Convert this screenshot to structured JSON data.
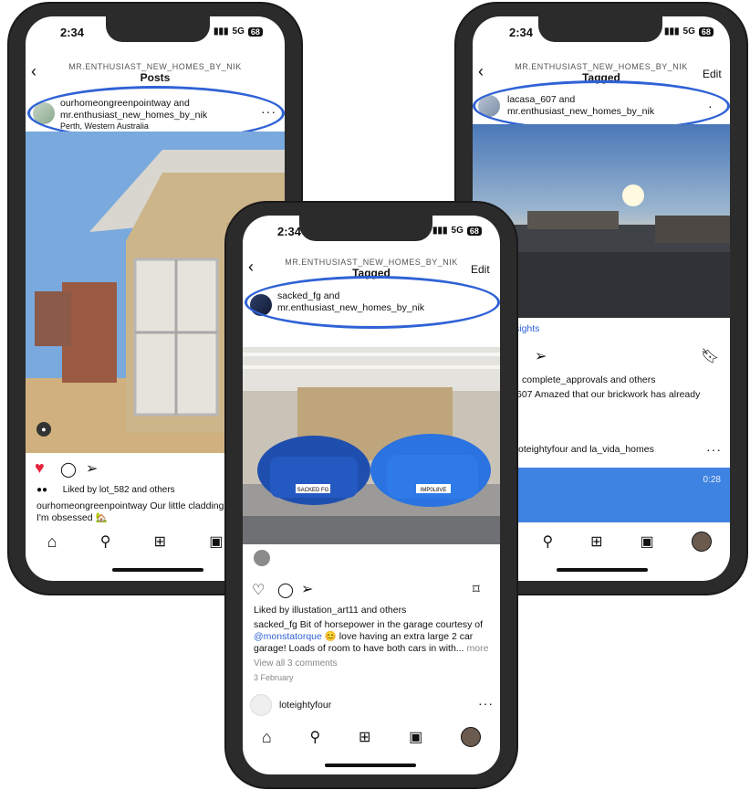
{
  "status": {
    "time": "2:34",
    "network": "5G",
    "battery": "68"
  },
  "profile_handle": "MR.ENTHUSIAST_NEW_HOMES_BY_NIK",
  "left": {
    "title": "Posts",
    "user1": "ourhomeongreenpointway",
    "and": "and",
    "user2": "mr.enthusiast_new_homes_by_nik",
    "location": "Perth, Western Australia",
    "liked_by_prefix": "Liked by",
    "liked_user": "lot_582",
    "liked_suffix": "and others",
    "caption_user": "ourhomeongreenpointway",
    "caption_text": "Our little cladding",
    "caption_line2": "I'm obsessed 🏡"
  },
  "right": {
    "title": "Tagged",
    "edit": "Edit",
    "user1": "lacasa_607",
    "and": "and",
    "user2": "mr.enthusiast_new_homes_by_nik",
    "insights": "sights",
    "liked_line": "complete_approvals and others",
    "caption_line": "607 Amazed that our brickwork has already",
    "v_text": "v",
    "next_post": "oteightyfour and la_vida_homes",
    "video_time": "0:28"
  },
  "center": {
    "title": "Tagged",
    "edit": "Edit",
    "user1": "sacked_fg",
    "and": "and",
    "user2": "mr.enthusiast_new_homes_by_nik",
    "liked_by_prefix": "Liked by",
    "liked_user": "illustation_art11",
    "liked_suffix": "and others",
    "caption_user": "sacked_fg",
    "caption_text": "Bit of horsepower in the garage courtesy of",
    "caption_mention": "@monstatorque",
    "caption_text2": "😊 love having an extra large 2 car",
    "caption_line3": "garage! Loads of room to have both cars in with...",
    "more": "more",
    "view_comments": "View all 3 comments",
    "date": "3 February",
    "next_user": "loteightyfour",
    "plate_left": "SACKED FG",
    "plate_right": "IMP0L8VE"
  },
  "colors": {
    "accent_circle": "#2f62d6",
    "like_red": "#e8233c",
    "link_blue": "#2f62d6"
  }
}
